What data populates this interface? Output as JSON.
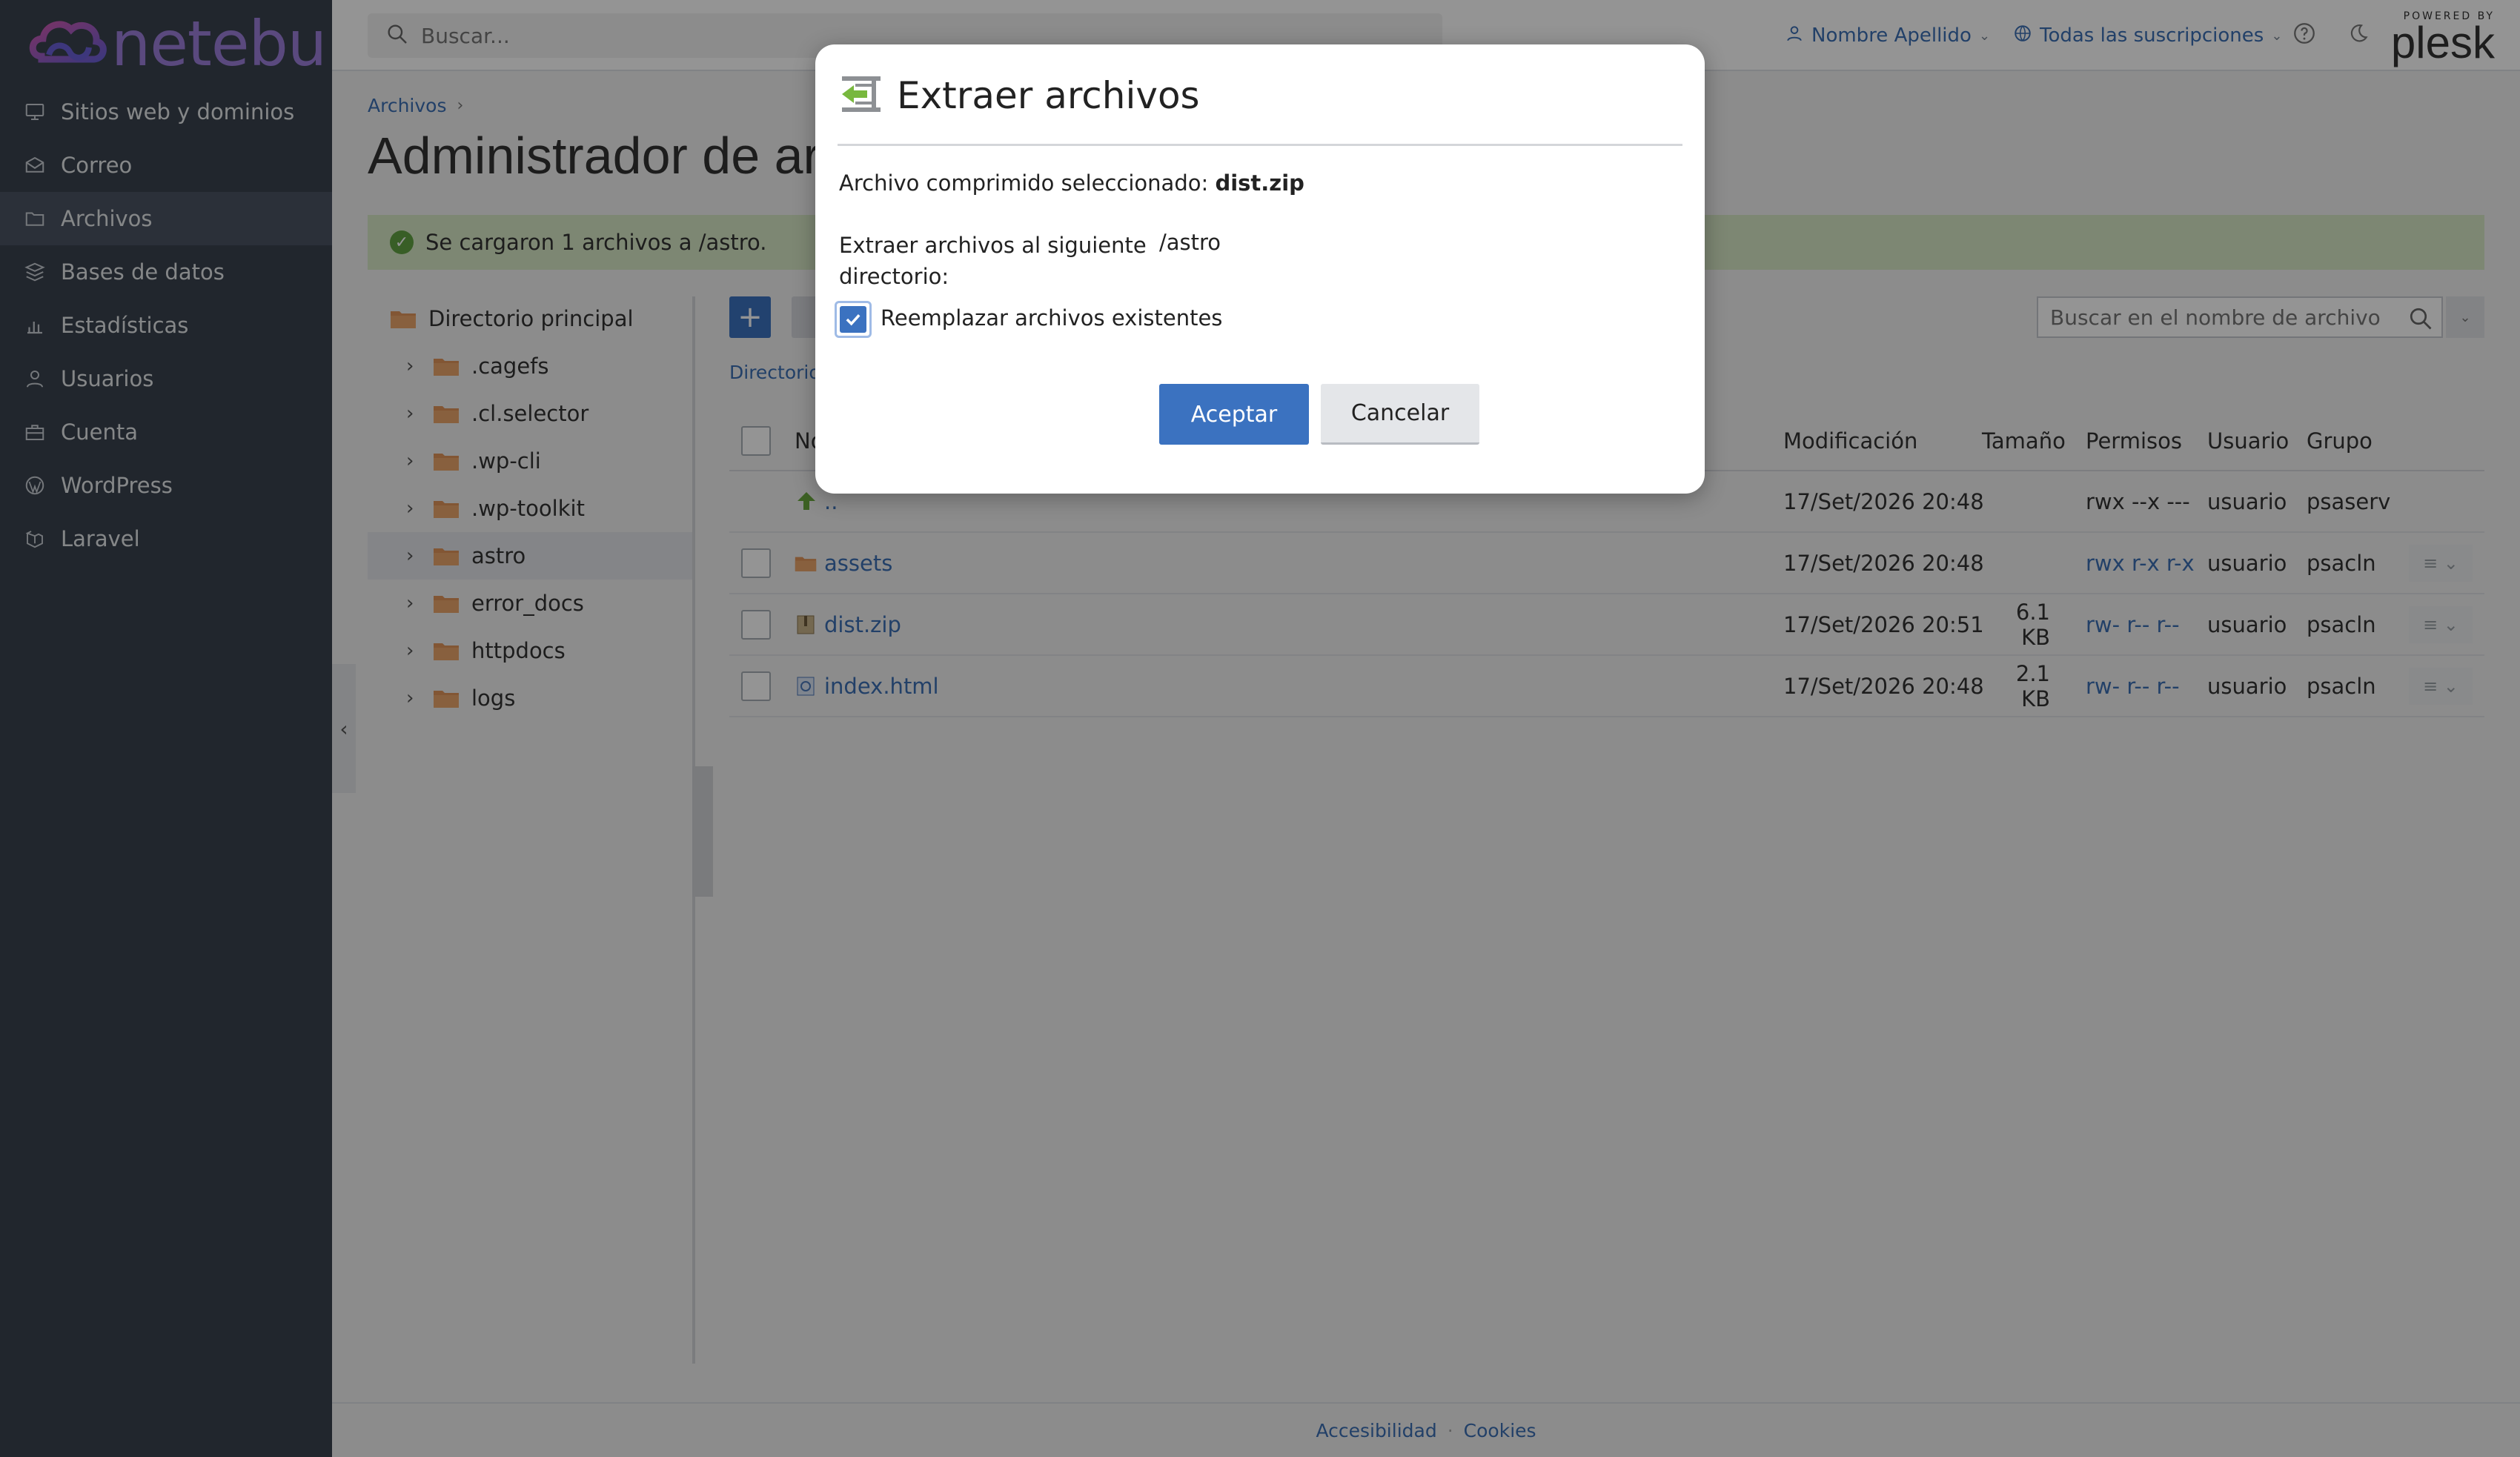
{
  "brand": {
    "logo_text": "netebu"
  },
  "sidebar": {
    "items": [
      {
        "label": "Sitios web y dominios",
        "icon": "monitor-icon"
      },
      {
        "label": "Correo",
        "icon": "mail-icon"
      },
      {
        "label": "Archivos",
        "icon": "folder-icon",
        "active": true
      },
      {
        "label": "Bases de datos",
        "icon": "database-icon"
      },
      {
        "label": "Estadísticas",
        "icon": "bar-chart-icon"
      },
      {
        "label": "Usuarios",
        "icon": "user-icon"
      },
      {
        "label": "Cuenta",
        "icon": "briefcase-icon"
      },
      {
        "label": "WordPress",
        "icon": "wordpress-icon"
      },
      {
        "label": "Laravel",
        "icon": "laravel-icon"
      }
    ]
  },
  "topbar": {
    "search_placeholder": "Buscar...",
    "user_name": "Nombre Apellido",
    "subscriptions": "Todas las suscripciones",
    "plesk_small": "POWERED BY",
    "plesk_big": "plesk"
  },
  "main": {
    "breadcrumb": "Archivos",
    "title": "Administrador de archivos",
    "success_message": "Se cargaron 1 archivos a /astro.",
    "file_search_placeholder": "Buscar en el nombre de archivo",
    "dir_link": "Directorio"
  },
  "tree": {
    "root": "Directorio principal",
    "children": [
      ".cagefs",
      ".cl.selector",
      ".wp-cli",
      ".wp-toolkit",
      "astro",
      "error_docs",
      "httpdocs",
      "logs"
    ],
    "active": "astro"
  },
  "table": {
    "headers": {
      "name": "Nombre",
      "modified": "Modificación",
      "size": "Tamaño",
      "permissions": "Permisos",
      "user": "Usuario",
      "group": "Grupo"
    },
    "rows": [
      {
        "name": "..",
        "type": "up",
        "modified": "17/Set/2026 20:48",
        "size": "",
        "permissions": "rwx --x ---",
        "user": "usuario",
        "group": "psaserv"
      },
      {
        "name": "assets",
        "type": "folder",
        "modified": "17/Set/2026 20:48",
        "size": "",
        "permissions": "rwx r-x r-x",
        "user": "usuario",
        "group": "psacln"
      },
      {
        "name": "dist.zip",
        "type": "zip",
        "modified": "17/Set/2026 20:51",
        "size": "6.1 KB",
        "permissions": "rw- r-- r--",
        "user": "usuario",
        "group": "psacln"
      },
      {
        "name": "index.html",
        "type": "html",
        "modified": "17/Set/2026 20:48",
        "size": "2.1 KB",
        "permissions": "rw- r-- r--",
        "user": "usuario",
        "group": "psacln"
      }
    ]
  },
  "dialog": {
    "title": "Extraer archivos",
    "selected_label": "Archivo comprimido seleccionado:",
    "selected_file": "dist.zip",
    "target_label": "Extraer archivos al siguiente directorio:",
    "target_value": "/astro",
    "replace_label": "Reemplazar archivos existentes",
    "replace_checked": true,
    "ok_label": "Aceptar",
    "cancel_label": "Cancelar"
  },
  "footer": {
    "accessibility": "Accesibilidad",
    "cookies": "Cookies"
  },
  "colors": {
    "sidebar": "#39424e",
    "accent": "#3b72c0",
    "success_bg": "#d8e8c6",
    "folder": "#e0955a"
  }
}
